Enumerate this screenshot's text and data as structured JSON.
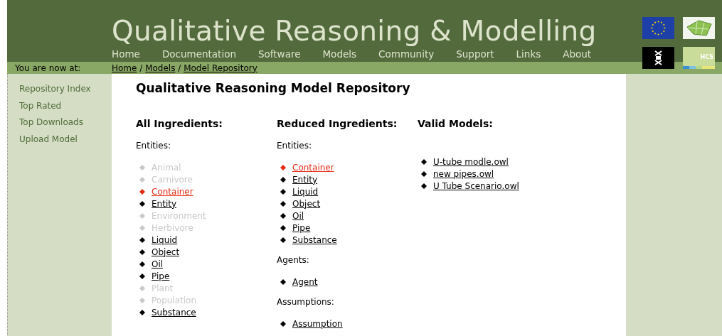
{
  "site_title": "Qualitative Reasoning & Modelling",
  "nav": [
    {
      "label": "Home"
    },
    {
      "label": "Documentation"
    },
    {
      "label": "Software"
    },
    {
      "label": "Models"
    },
    {
      "label": "Community"
    },
    {
      "label": "Support"
    },
    {
      "label": "Links"
    },
    {
      "label": "About"
    }
  ],
  "logo_text": "HCS",
  "breadcrumb": {
    "label": "You are now at:",
    "separator": "/",
    "links": [
      "Home",
      "Models",
      "Model Repository"
    ]
  },
  "sidebar": {
    "items": [
      "Repository Index",
      "Top Rated",
      "Top Downloads",
      "Upload Model"
    ]
  },
  "page_title": "Qualitative Reasoning Model Repository",
  "columns": [
    {
      "heading": "All Ingredients:",
      "groups": [
        {
          "label": "Entities:",
          "items": [
            {
              "text": "Animal",
              "selected": false,
              "disabled": true
            },
            {
              "text": "Carnivore",
              "selected": false,
              "disabled": true
            },
            {
              "text": "Container",
              "selected": true,
              "disabled": false
            },
            {
              "text": "Entity",
              "selected": false,
              "disabled": false
            },
            {
              "text": "Environment",
              "selected": false,
              "disabled": true
            },
            {
              "text": "Herbivore",
              "selected": false,
              "disabled": true
            },
            {
              "text": "Liquid",
              "selected": false,
              "disabled": false
            },
            {
              "text": "Object",
              "selected": false,
              "disabled": false
            },
            {
              "text": "Oil",
              "selected": false,
              "disabled": false
            },
            {
              "text": "Pipe",
              "selected": false,
              "disabled": false
            },
            {
              "text": "Plant",
              "selected": false,
              "disabled": true
            },
            {
              "text": "Population",
              "selected": false,
              "disabled": true
            },
            {
              "text": "Substance",
              "selected": false,
              "disabled": false
            }
          ]
        }
      ]
    },
    {
      "heading": "Reduced Ingredients:",
      "groups": [
        {
          "label": "Entities:",
          "items": [
            {
              "text": "Container",
              "selected": true,
              "disabled": false
            },
            {
              "text": "Entity",
              "selected": false,
              "disabled": false
            },
            {
              "text": "Liquid",
              "selected": false,
              "disabled": false
            },
            {
              "text": "Object",
              "selected": false,
              "disabled": false
            },
            {
              "text": "Oil",
              "selected": false,
              "disabled": false
            },
            {
              "text": "Pipe",
              "selected": false,
              "disabled": false
            },
            {
              "text": "Substance",
              "selected": false,
              "disabled": false
            }
          ]
        },
        {
          "label": "Agents:",
          "items": [
            {
              "text": "Agent",
              "selected": false,
              "disabled": false
            }
          ]
        },
        {
          "label": "Assumptions:",
          "items": [
            {
              "text": "Assumption",
              "selected": false,
              "disabled": false
            }
          ]
        }
      ]
    },
    {
      "heading": "Valid Models:",
      "groups": [
        {
          "items": [
            {
              "text": "U-tube modle.owl",
              "selected": false,
              "disabled": false
            },
            {
              "text": "new pipes.owl",
              "selected": false,
              "disabled": false
            },
            {
              "text": "U Tube Scenario.owl",
              "selected": false,
              "disabled": false
            }
          ]
        }
      ]
    }
  ]
}
